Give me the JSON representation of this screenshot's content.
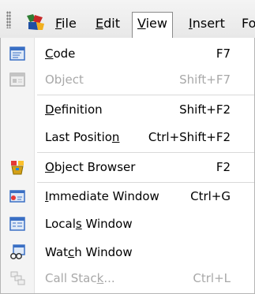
{
  "menubar": {
    "menus": [
      {
        "pre": "",
        "ul": "F",
        "post": "ile"
      },
      {
        "pre": "",
        "ul": "E",
        "post": "dit"
      },
      {
        "pre": "",
        "ul": "V",
        "post": "iew"
      },
      {
        "pre": "",
        "ul": "I",
        "post": "nsert"
      },
      {
        "pre": "F",
        "ul": "",
        "post": "o"
      }
    ]
  },
  "view_menu": {
    "items": [
      {
        "pre": "",
        "ul": "C",
        "post": "ode",
        "shortcut": "F7",
        "enabled": true,
        "icon": "code-window-icon"
      },
      {
        "pre": "Ob",
        "ul": "j",
        "post": "ect",
        "shortcut": "Shift+F7",
        "enabled": false,
        "icon": "object-icon"
      },
      {
        "pre": "",
        "ul": "D",
        "post": "efinition",
        "shortcut": "Shift+F2",
        "enabled": true
      },
      {
        "pre": "Last Positio",
        "ul": "n",
        "post": "",
        "shortcut": "Ctrl+Shift+F2",
        "enabled": true
      },
      {
        "pre": "",
        "ul": "O",
        "post": "bject Browser",
        "shortcut": "F2",
        "enabled": true,
        "icon": "object-browser-icon"
      },
      {
        "pre": "",
        "ul": "I",
        "post": "mmediate Window",
        "shortcut": "Ctrl+G",
        "enabled": true,
        "icon": "immediate-window-icon"
      },
      {
        "pre": "Local",
        "ul": "s",
        "post": " Window",
        "shortcut": "",
        "enabled": true,
        "icon": "locals-window-icon"
      },
      {
        "pre": "Wat",
        "ul": "c",
        "post": "h Window",
        "shortcut": "",
        "enabled": true,
        "icon": "watch-window-icon"
      },
      {
        "pre": "Call Stac",
        "ul": "k",
        "post": "...",
        "shortcut": "Ctrl+L",
        "enabled": false,
        "icon": "call-stack-icon"
      }
    ]
  },
  "colors": {
    "menu_bg": "#f4f4f4",
    "disabled_text": "#a8a8a8",
    "icon_blue": "#3a6fc4"
  }
}
